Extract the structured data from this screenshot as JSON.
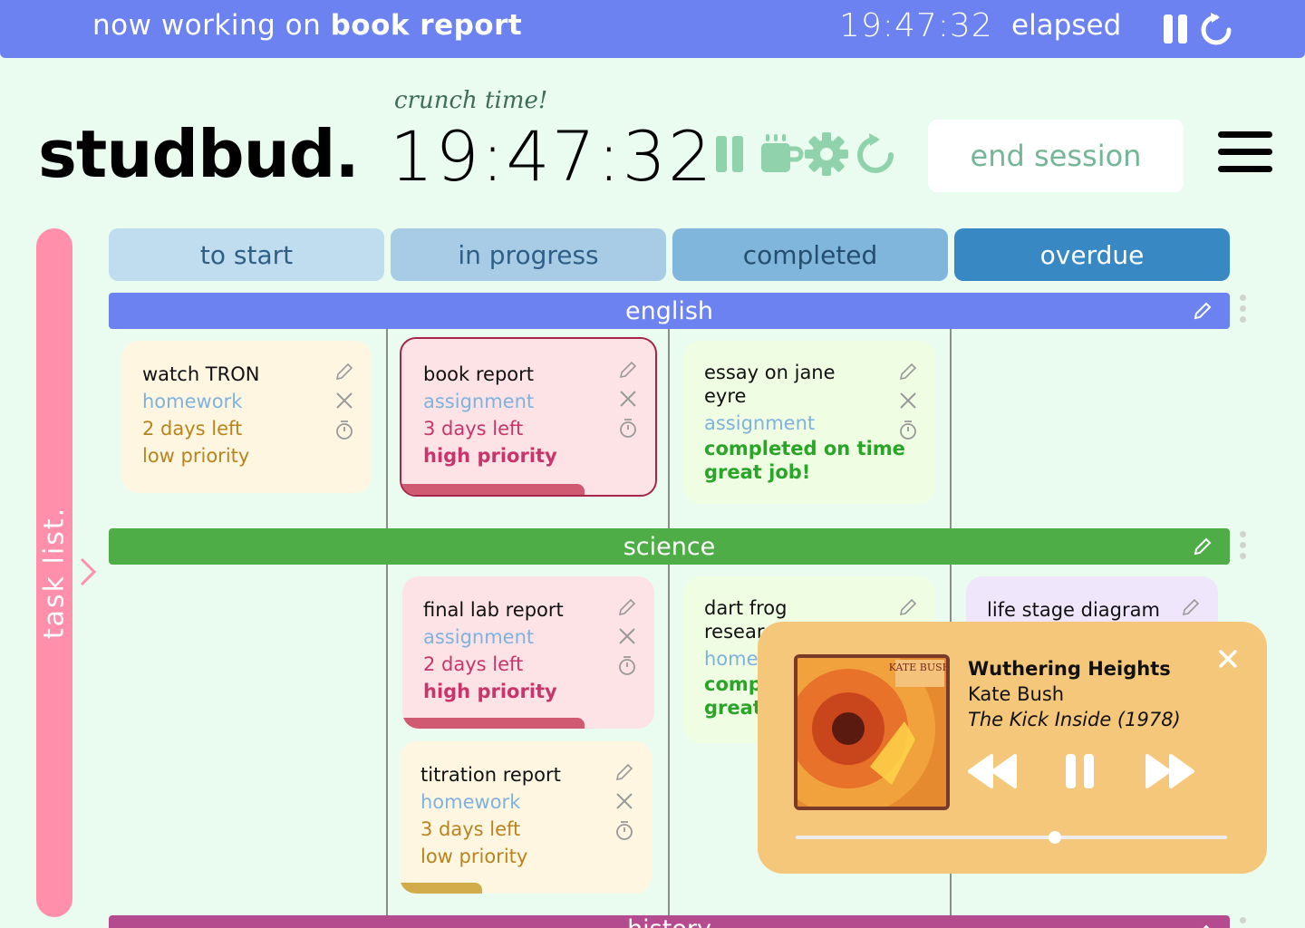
{
  "topbar": {
    "working_prefix": "now working on",
    "working_task": "book report",
    "elapsed_time": "19:47:32",
    "elapsed_label": "elapsed"
  },
  "header": {
    "app_name": "studbud.",
    "tagline": "crunch time!",
    "timer": "19:47:32",
    "end_session_label": "end session"
  },
  "sidebar": {
    "label": "task list."
  },
  "columns": [
    {
      "label": "to start",
      "bg": "#c0dcef",
      "color": "#2f5f86"
    },
    {
      "label": "in progress",
      "bg": "#a8cce6",
      "color": "#2f5f86"
    },
    {
      "label": "completed",
      "bg": "#80b6dc",
      "color": "#244d70"
    },
    {
      "label": "overdue",
      "bg": "#3888c4",
      "color": "#ffffff"
    }
  ],
  "subjects": [
    {
      "name": "english",
      "color": "#6b82f0"
    },
    {
      "name": "science",
      "color": "#4fad47"
    },
    {
      "name": "history",
      "color": "#b34b8e"
    }
  ],
  "cards": {
    "watch_tron": {
      "title": "watch TRON",
      "type": "homework",
      "due": "2 days left",
      "priority": "low priority"
    },
    "book_report": {
      "title": "book report",
      "type": "assignment",
      "due": "3 days left",
      "priority": "high priority"
    },
    "essay": {
      "title_1": "essay on jane",
      "title_2": "eyre",
      "type": "assignment",
      "status_1": "completed on time",
      "status_2": "great job!"
    },
    "final_lab": {
      "title": "final lab report",
      "type": "assignment",
      "due": "2 days left",
      "priority": "high priority"
    },
    "titration": {
      "title": "titration report",
      "type": "homework",
      "due": "3 days left",
      "priority": "low priority"
    },
    "dart_frog": {
      "title_1": "dart frog",
      "title_2": "researc",
      "type": "home",
      "status_1": "comp",
      "status_2": "great"
    },
    "life_stage": {
      "title": "life stage diagram"
    }
  },
  "player": {
    "song": "Wuthering Heights",
    "artist": "Kate Bush",
    "album": "The Kick Inside (1978)",
    "progress": 0.6,
    "album_art_text": "KATE BUSH"
  },
  "colors": {
    "accent_blue": "#6b82f0",
    "rail_pink": "#ff8fab",
    "low_priority": "#b8841d",
    "high_priority": "#c9346a",
    "completed_green": "#2aa52a"
  }
}
